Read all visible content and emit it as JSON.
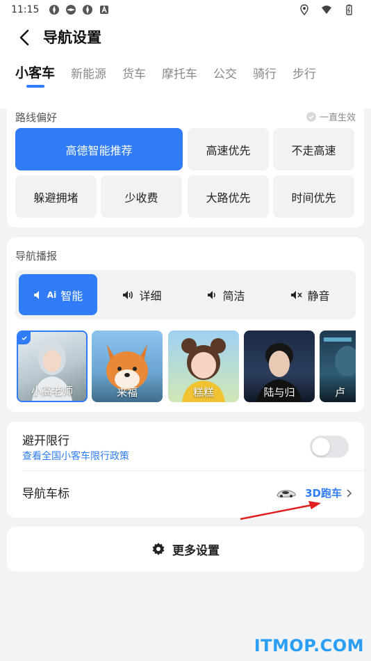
{
  "status_bar": {
    "time": "11:15"
  },
  "header": {
    "title": "导航设置",
    "tabs": [
      "小客车",
      "新能源",
      "货车",
      "摩托车",
      "公交",
      "骑行",
      "步行"
    ]
  },
  "route_pref": {
    "title": "路线偏好",
    "always_effective": "一直生效",
    "options": [
      "高德智能推荐",
      "高速优先",
      "不走高速",
      "躲避拥堵",
      "少收费",
      "大路优先",
      "时间优先"
    ]
  },
  "voice": {
    "title": "导航播报",
    "modes": [
      "智能",
      "详细",
      "简洁",
      "静音"
    ],
    "ai_badge": "Ai",
    "avatars": [
      "小高老师",
      "来福",
      "糕糕",
      "陆与归",
      "卢"
    ]
  },
  "settings": {
    "restriction_title": "避开限行",
    "restriction_link": "查看全国小客车限行政策",
    "restriction_enabled": false,
    "car_icon_title": "导航车标",
    "car_icon_value": "3D跑车"
  },
  "more_settings": "更多设置",
  "watermark": "ITMOP.COM",
  "colors": {
    "accent": "#2f7cf6",
    "background": "#f2f3f5",
    "annotation_arrow": "#e02020"
  }
}
